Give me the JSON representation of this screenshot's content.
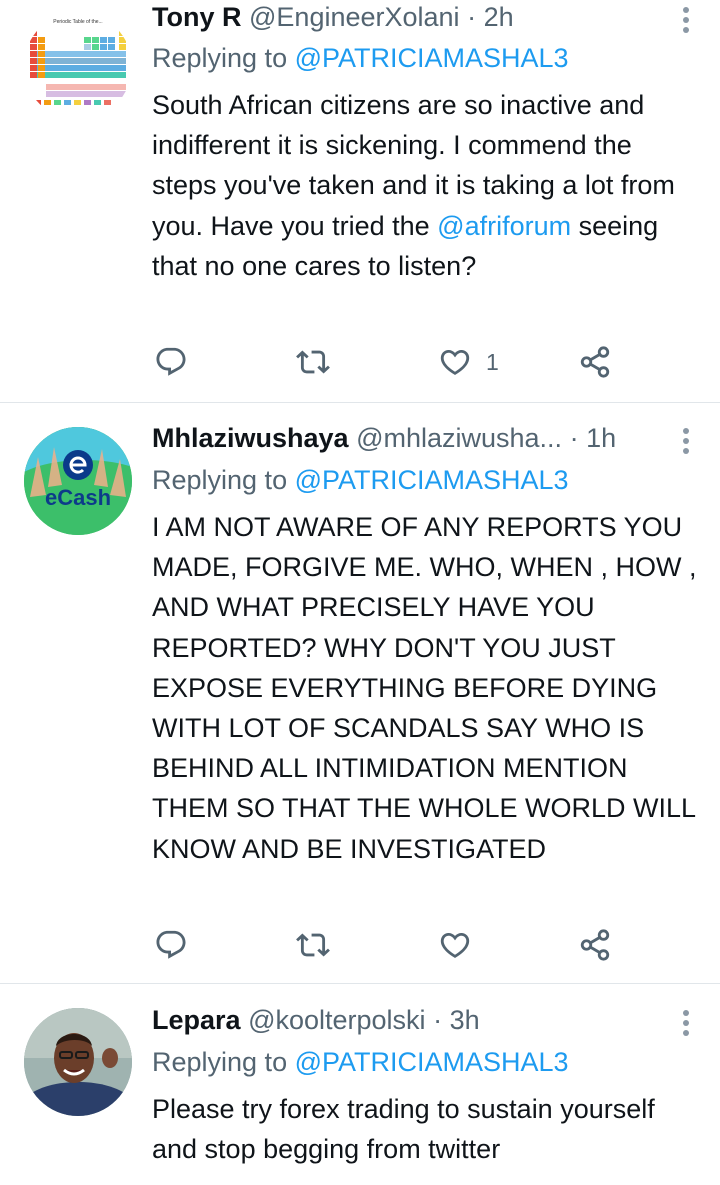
{
  "tweets": [
    {
      "name": "Tony R",
      "handle": "@EngineerXolani",
      "sep": "·",
      "time": "2h",
      "replying_prefix": "Replying to",
      "replying_handle": "@PATRICIAMASHAL3",
      "text_a": "South African citizens are so inactive and indifferent it is sickening. I commend the steps you've taken and it is taking a lot from you. Have you tried the ",
      "mention": "@afriforum",
      "text_b": " seeing that no one cares to listen?",
      "like_count": "1",
      "avatar_caption": "Periodic Table of the..."
    },
    {
      "name": "Mhlaziwushaya",
      "handle": "@mhlaziwusha...",
      "sep": "·",
      "time": "1h",
      "replying_prefix": "Replying to",
      "replying_handle": "@PATRICIAMASHAL3",
      "text": "I AM NOT AWARE OF ANY REPORTS YOU MADE, FORGIVE ME. WHO, WHEN , HOW , AND WHAT PRECISELY HAVE YOU REPORTED? WHY DON'T YOU JUST EXPOSE EVERYTHING BEFORE DYING WITH LOT OF SCANDALS SAY WHO IS BEHIND ALL INTIMIDATION MENTION THEM SO THAT THE WHOLE WORLD WILL KNOW AND BE INVESTIGATED",
      "like_count": "",
      "avatar_text": "eCash"
    },
    {
      "name": "Lepara",
      "handle": "@koolterpolski",
      "sep": "·",
      "time": "3h",
      "replying_prefix": "Replying to",
      "replying_handle": "@PATRICIAMASHAL3",
      "text": "Please try forex trading to sustain yourself and stop begging from twitter"
    }
  ],
  "colors": {
    "link": "#1d9bf0",
    "secondary": "#536471",
    "text": "#0f1419",
    "divider": "#e1e6ea"
  },
  "icons": [
    "reply-icon",
    "retweet-icon",
    "like-icon",
    "share-icon",
    "more-icon"
  ]
}
